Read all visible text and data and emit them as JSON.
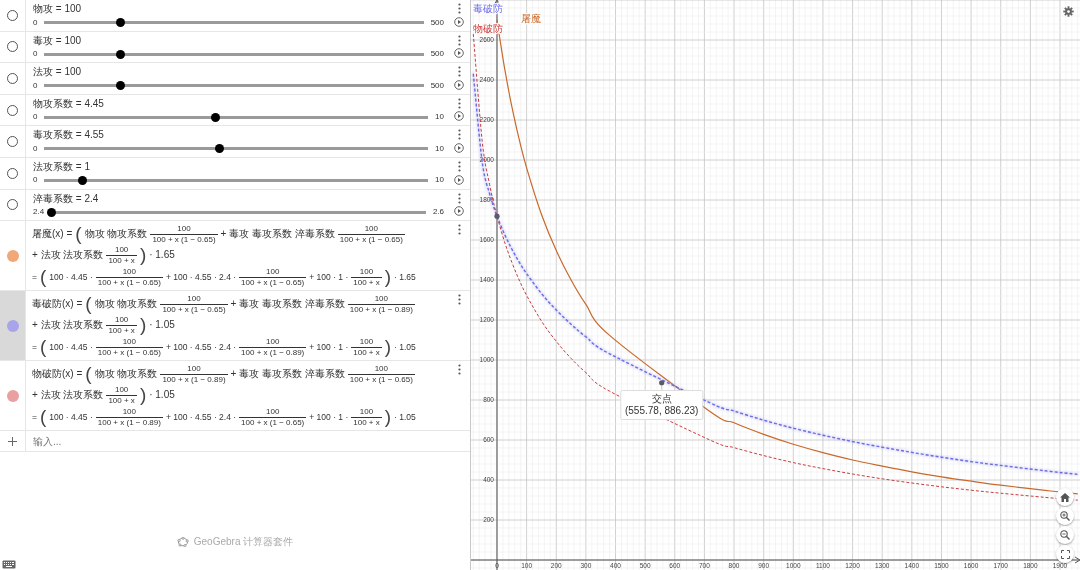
{
  "algebra": {
    "sliders": [
      {
        "label": "物攻 = 100",
        "min": "0",
        "max": "500",
        "level": 0.2,
        "visible": false
      },
      {
        "label": "毒攻 = 100",
        "min": "0",
        "max": "500",
        "level": 0.2,
        "visible": false
      },
      {
        "label": "法攻 = 100",
        "min": "0",
        "max": "500",
        "level": 0.2,
        "visible": false
      },
      {
        "label": "物攻系数 = 4.45",
        "min": "0",
        "max": "10",
        "level": 0.445,
        "visible": false
      },
      {
        "label": "毒攻系数 = 4.55",
        "min": "0",
        "max": "10",
        "level": 0.455,
        "visible": false
      },
      {
        "label": "法攻系数 = 1",
        "min": "0",
        "max": "10",
        "level": 0.1,
        "visible": false
      },
      {
        "label": "淬毒系数 = 2.4",
        "min": "2.4",
        "max": "2.6",
        "level": 0,
        "visible": false
      }
    ],
    "functions": [
      {
        "color": "#f0a878",
        "visible": true,
        "selected": false,
        "definition": [
          {
            "kind": "text",
            "text": "屠魔(x) ="
          },
          {
            "kind": "paren",
            "text": "("
          },
          {
            "kind": "text",
            "text": "物攻 物攻系数"
          },
          {
            "kind": "frac",
            "num": "100",
            "den": "100 + x (1 − 0.65)"
          },
          {
            "kind": "text",
            "text": "+ 毒攻 毒攻系数 淬毒系数"
          },
          {
            "kind": "frac",
            "num": "100",
            "den": "100 + x (1 − 0.65)"
          },
          {
            "kind": "text",
            "text": "+ 法攻 法攻系数"
          },
          {
            "kind": "frac",
            "num": "100",
            "den": "100 + x"
          },
          {
            "kind": "paren",
            "text": ")"
          },
          {
            "kind": "text",
            "text": "· 1.65"
          }
        ],
        "value": [
          {
            "kind": "text",
            "text": "="
          },
          {
            "kind": "paren",
            "text": "("
          },
          {
            "kind": "text",
            "text": "100 · 4.45 ·"
          },
          {
            "kind": "frac",
            "num": "100",
            "den": "100 + x (1 − 0.65)"
          },
          {
            "kind": "text",
            "text": "+ 100 · 4.55 · 2.4 ·"
          },
          {
            "kind": "frac",
            "num": "100",
            "den": "100 + x (1 − 0.65)"
          },
          {
            "kind": "text",
            "text": "+ 100 · 1 ·"
          },
          {
            "kind": "frac",
            "num": "100",
            "den": "100 + x"
          },
          {
            "kind": "paren",
            "text": ")"
          },
          {
            "kind": "text",
            "text": "· 1.65"
          }
        ]
      },
      {
        "color": "#a9a3ea",
        "visible": true,
        "selected": true,
        "definition": [
          {
            "kind": "text",
            "text": "毒破防(x) ="
          },
          {
            "kind": "paren",
            "text": "("
          },
          {
            "kind": "text",
            "text": "物攻 物攻系数"
          },
          {
            "kind": "frac",
            "num": "100",
            "den": "100 + x (1 − 0.65)"
          },
          {
            "kind": "text",
            "text": "+ 毒攻 毒攻系数 淬毒系数"
          },
          {
            "kind": "frac",
            "num": "100",
            "den": "100 + x (1 − 0.89)"
          },
          {
            "kind": "text",
            "text": "+ 法攻 法攻系数"
          },
          {
            "kind": "frac",
            "num": "100",
            "den": "100 + x"
          },
          {
            "kind": "paren",
            "text": ")"
          },
          {
            "kind": "text",
            "text": "· 1.05"
          }
        ],
        "value": [
          {
            "kind": "text",
            "text": "="
          },
          {
            "kind": "paren",
            "text": "("
          },
          {
            "kind": "text",
            "text": "100 · 4.45 ·"
          },
          {
            "kind": "frac",
            "num": "100",
            "den": "100 + x (1 − 0.65)"
          },
          {
            "kind": "text",
            "text": "+ 100 · 4.55 · 2.4 ·"
          },
          {
            "kind": "frac",
            "num": "100",
            "den": "100 + x (1 − 0.89)"
          },
          {
            "kind": "text",
            "text": "+ 100 · 1 ·"
          },
          {
            "kind": "frac",
            "num": "100",
            "den": "100 + x"
          },
          {
            "kind": "paren",
            "text": ")"
          },
          {
            "kind": "text",
            "text": "· 1.05"
          }
        ]
      },
      {
        "color": "#eaa0a0",
        "visible": true,
        "selected": false,
        "definition": [
          {
            "kind": "text",
            "text": "物破防(x) ="
          },
          {
            "kind": "paren",
            "text": "("
          },
          {
            "kind": "text",
            "text": "物攻 物攻系数"
          },
          {
            "kind": "frac",
            "num": "100",
            "den": "100 + x (1 − 0.89)"
          },
          {
            "kind": "text",
            "text": "+ 毒攻 毒攻系数 淬毒系数"
          },
          {
            "kind": "frac",
            "num": "100",
            "den": "100 + x (1 − 0.65)"
          },
          {
            "kind": "text",
            "text": "+ 法攻 法攻系数"
          },
          {
            "kind": "frac",
            "num": "100",
            "den": "100 + x"
          },
          {
            "kind": "paren",
            "text": ")"
          },
          {
            "kind": "text",
            "text": "· 1.05"
          }
        ],
        "value": [
          {
            "kind": "text",
            "text": "="
          },
          {
            "kind": "paren",
            "text": "("
          },
          {
            "kind": "text",
            "text": "100 · 4.45 ·"
          },
          {
            "kind": "frac",
            "num": "100",
            "den": "100 + x (1 − 0.89)"
          },
          {
            "kind": "text",
            "text": "+ 100 · 4.55 · 2.4 ·"
          },
          {
            "kind": "frac",
            "num": "100",
            "den": "100 + x (1 − 0.65)"
          },
          {
            "kind": "text",
            "text": "+ 100 · 1 ·"
          },
          {
            "kind": "frac",
            "num": "100",
            "den": "100 + x"
          },
          {
            "kind": "paren",
            "text": ")"
          },
          {
            "kind": "text",
            "text": "· 1.05"
          }
        ]
      }
    ],
    "input": {
      "placeholder": "输入..."
    },
    "footer": "GeoGebra 计算器套件"
  },
  "graph": {
    "chart_data": {
      "type": "line",
      "x": [
        -80,
        -50,
        -25,
        -5,
        0,
        25,
        50,
        75,
        100,
        150,
        200,
        250,
        300,
        380,
        720,
        800,
        900,
        1000,
        1100,
        1200,
        1300,
        1400,
        1500,
        1600,
        1700,
        1850,
        1960
      ],
      "series": [
        {
          "name": "屠魔",
          "color": "#c8692b",
          "line_style": "solid",
          "values": [
            null,
            null,
            null,
            null,
            2701,
            2464,
            2268,
            2103,
            1961,
            1729,
            1547,
            1400,
            1278,
            1123,
            741,
            686,
            628,
            579,
            537,
            500,
            469,
            441,
            416,
            394,
            374,
            348,
            331
          ]
        },
        {
          "name": "毒破防",
          "color": "#6c6ce6",
          "line_style": "dashed",
          "values": [
            2431,
            1990,
            1831,
            1739,
            1719,
            1630,
            1555,
            1489,
            1432,
            1333,
            1250,
            1179,
            1116,
            1031,
            785,
            745,
            699,
            659,
            624,
            592,
            564,
            538,
            514,
            492,
            473,
            446,
            428
          ]
        },
        {
          "name": "物破防",
          "color": "#c83c3c",
          "line_style": "dashed",
          "values": [
            2630,
            2094,
            1877,
            1747,
            1719,
            1593,
            1489,
            1400,
            1323,
            1195,
            1093,
            1008,
            937,
            844,
            599,
            562,
            522,
            487,
            457,
            430,
            406,
            385,
            366,
            349,
            334,
            313,
            299
          ]
        }
      ],
      "grid": true,
      "xlim": [
        -87.7,
        1967.5
      ],
      "ylim": [
        -50,
        2800
      ],
      "xticks": [
        0,
        100,
        200,
        300,
        400,
        500,
        600,
        700,
        800,
        900,
        1000,
        1100,
        1200,
        1300,
        1400,
        1500,
        1600,
        1700,
        1800,
        1900
      ],
      "yticks": [
        200,
        400,
        600,
        800,
        1000,
        1200,
        1400,
        1600,
        1800,
        2000,
        2200,
        2400,
        2600
      ],
      "annotations": [
        {
          "x": 555.78,
          "y": 886.23,
          "text": "交点\n(555.78, 886.23)"
        }
      ]
    }
  }
}
